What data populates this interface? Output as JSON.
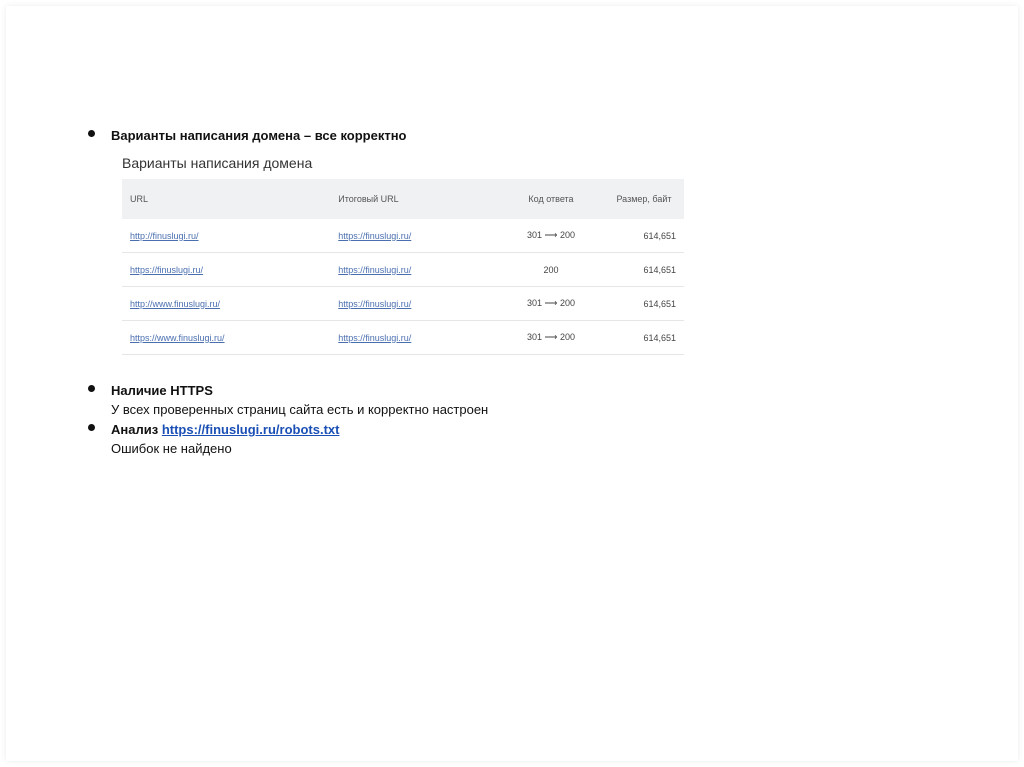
{
  "bullets": {
    "domain_variants": "Варианты написания домена – все корректно",
    "https_title": "Наличие HTTPS",
    "https_note": "У всех проверенных страниц сайта есть и корректно настроен",
    "analysis_prefix": "Анализ",
    "analysis_link": "https://finuslugi.ru/robots.txt",
    "analysis_note": "Ошибок не найдено"
  },
  "table": {
    "caption": "Варианты написания домена",
    "headers": {
      "url": "URL",
      "final_url": "Итоговый URL",
      "code": "Код ответа",
      "size": "Размер, байт"
    },
    "rows": [
      {
        "url": "http://finuslugi.ru/",
        "final_url": "https://finuslugi.ru/",
        "code": "301 ⟶ 200",
        "size": "614,651"
      },
      {
        "url": "https://finuslugi.ru/",
        "final_url": "https://finuslugi.ru/",
        "code": "200",
        "size": "614,651"
      },
      {
        "url": "http://www.finuslugi.ru/",
        "final_url": "https://finuslugi.ru/",
        "code": "301 ⟶ 200",
        "size": "614,651"
      },
      {
        "url": "https://www.finuslugi.ru/",
        "final_url": "https://finuslugi.ru/",
        "code": "301 ⟶ 200",
        "size": "614,651"
      }
    ]
  }
}
